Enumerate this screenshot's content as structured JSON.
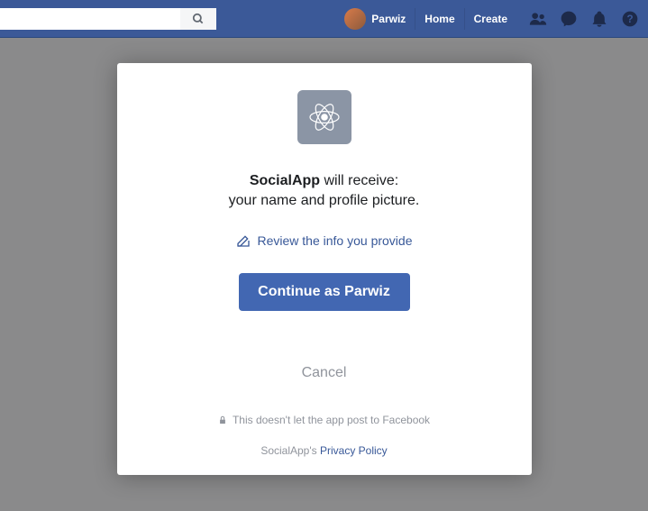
{
  "header": {
    "user_name": "Parwiz",
    "nav": {
      "home": "Home",
      "create": "Create"
    }
  },
  "dialog": {
    "app_name": "SocialApp",
    "receive_suffix": " will receive:",
    "permissions_line": "your name and profile picture.",
    "review_link": "Review the info you provide",
    "continue_label": "Continue as Parwiz",
    "cancel_label": "Cancel",
    "disclaimer": "This doesn't let the app post to Facebook",
    "privacy_prefix": "SocialApp's ",
    "privacy_link": "Privacy Policy"
  }
}
